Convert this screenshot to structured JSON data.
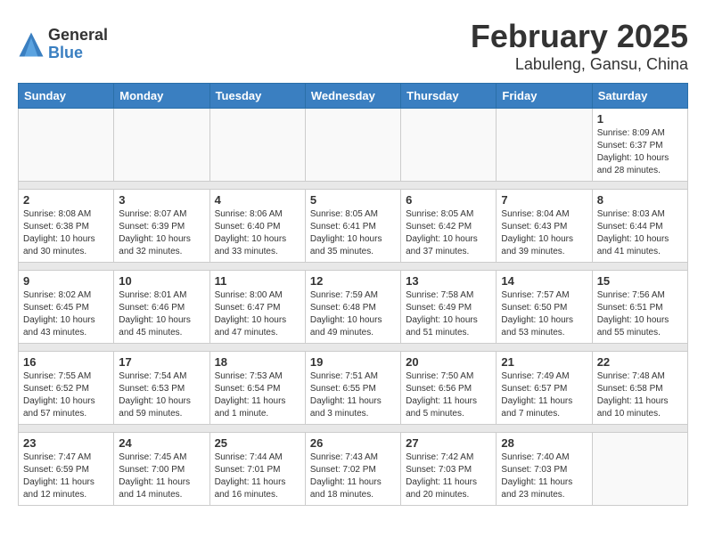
{
  "logo": {
    "general": "General",
    "blue": "Blue"
  },
  "title": "February 2025",
  "subtitle": "Labuleng, Gansu, China",
  "days_of_week": [
    "Sunday",
    "Monday",
    "Tuesday",
    "Wednesday",
    "Thursday",
    "Friday",
    "Saturday"
  ],
  "weeks": [
    [
      {
        "day": "",
        "info": ""
      },
      {
        "day": "",
        "info": ""
      },
      {
        "day": "",
        "info": ""
      },
      {
        "day": "",
        "info": ""
      },
      {
        "day": "",
        "info": ""
      },
      {
        "day": "",
        "info": ""
      },
      {
        "day": "1",
        "info": "Sunrise: 8:09 AM\nSunset: 6:37 PM\nDaylight: 10 hours and 28 minutes."
      }
    ],
    [
      {
        "day": "2",
        "info": "Sunrise: 8:08 AM\nSunset: 6:38 PM\nDaylight: 10 hours and 30 minutes."
      },
      {
        "day": "3",
        "info": "Sunrise: 8:07 AM\nSunset: 6:39 PM\nDaylight: 10 hours and 32 minutes."
      },
      {
        "day": "4",
        "info": "Sunrise: 8:06 AM\nSunset: 6:40 PM\nDaylight: 10 hours and 33 minutes."
      },
      {
        "day": "5",
        "info": "Sunrise: 8:05 AM\nSunset: 6:41 PM\nDaylight: 10 hours and 35 minutes."
      },
      {
        "day": "6",
        "info": "Sunrise: 8:05 AM\nSunset: 6:42 PM\nDaylight: 10 hours and 37 minutes."
      },
      {
        "day": "7",
        "info": "Sunrise: 8:04 AM\nSunset: 6:43 PM\nDaylight: 10 hours and 39 minutes."
      },
      {
        "day": "8",
        "info": "Sunrise: 8:03 AM\nSunset: 6:44 PM\nDaylight: 10 hours and 41 minutes."
      }
    ],
    [
      {
        "day": "9",
        "info": "Sunrise: 8:02 AM\nSunset: 6:45 PM\nDaylight: 10 hours and 43 minutes."
      },
      {
        "day": "10",
        "info": "Sunrise: 8:01 AM\nSunset: 6:46 PM\nDaylight: 10 hours and 45 minutes."
      },
      {
        "day": "11",
        "info": "Sunrise: 8:00 AM\nSunset: 6:47 PM\nDaylight: 10 hours and 47 minutes."
      },
      {
        "day": "12",
        "info": "Sunrise: 7:59 AM\nSunset: 6:48 PM\nDaylight: 10 hours and 49 minutes."
      },
      {
        "day": "13",
        "info": "Sunrise: 7:58 AM\nSunset: 6:49 PM\nDaylight: 10 hours and 51 minutes."
      },
      {
        "day": "14",
        "info": "Sunrise: 7:57 AM\nSunset: 6:50 PM\nDaylight: 10 hours and 53 minutes."
      },
      {
        "day": "15",
        "info": "Sunrise: 7:56 AM\nSunset: 6:51 PM\nDaylight: 10 hours and 55 minutes."
      }
    ],
    [
      {
        "day": "16",
        "info": "Sunrise: 7:55 AM\nSunset: 6:52 PM\nDaylight: 10 hours and 57 minutes."
      },
      {
        "day": "17",
        "info": "Sunrise: 7:54 AM\nSunset: 6:53 PM\nDaylight: 10 hours and 59 minutes."
      },
      {
        "day": "18",
        "info": "Sunrise: 7:53 AM\nSunset: 6:54 PM\nDaylight: 11 hours and 1 minute."
      },
      {
        "day": "19",
        "info": "Sunrise: 7:51 AM\nSunset: 6:55 PM\nDaylight: 11 hours and 3 minutes."
      },
      {
        "day": "20",
        "info": "Sunrise: 7:50 AM\nSunset: 6:56 PM\nDaylight: 11 hours and 5 minutes."
      },
      {
        "day": "21",
        "info": "Sunrise: 7:49 AM\nSunset: 6:57 PM\nDaylight: 11 hours and 7 minutes."
      },
      {
        "day": "22",
        "info": "Sunrise: 7:48 AM\nSunset: 6:58 PM\nDaylight: 11 hours and 10 minutes."
      }
    ],
    [
      {
        "day": "23",
        "info": "Sunrise: 7:47 AM\nSunset: 6:59 PM\nDaylight: 11 hours and 12 minutes."
      },
      {
        "day": "24",
        "info": "Sunrise: 7:45 AM\nSunset: 7:00 PM\nDaylight: 11 hours and 14 minutes."
      },
      {
        "day": "25",
        "info": "Sunrise: 7:44 AM\nSunset: 7:01 PM\nDaylight: 11 hours and 16 minutes."
      },
      {
        "day": "26",
        "info": "Sunrise: 7:43 AM\nSunset: 7:02 PM\nDaylight: 11 hours and 18 minutes."
      },
      {
        "day": "27",
        "info": "Sunrise: 7:42 AM\nSunset: 7:03 PM\nDaylight: 11 hours and 20 minutes."
      },
      {
        "day": "28",
        "info": "Sunrise: 7:40 AM\nSunset: 7:03 PM\nDaylight: 11 hours and 23 minutes."
      },
      {
        "day": "",
        "info": ""
      }
    ]
  ]
}
